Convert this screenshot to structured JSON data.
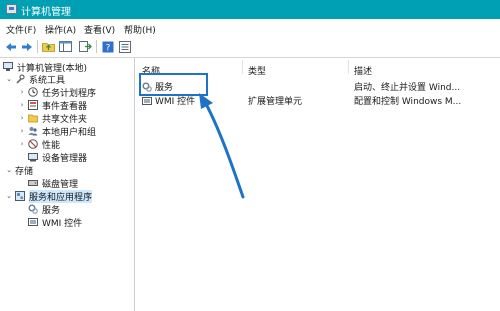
{
  "window": {
    "title": "计算机管理",
    "icon": "computer-management-icon"
  },
  "menu": {
    "file": "文件(F)",
    "action": "操作(A)",
    "view": "查看(V)",
    "help": "帮助(H)"
  },
  "toolbar": {
    "icons": [
      "back-arrow-icon",
      "forward-arrow-icon",
      "folder-up-icon",
      "show-hide-tree-icon",
      "export-list-icon",
      "help-icon",
      "properties-icon"
    ]
  },
  "tree": {
    "root": "计算机管理(本地)",
    "system_tools": "系统工具",
    "task_scheduler": "任务计划程序",
    "event_viewer": "事件查看器",
    "shared_folders": "共享文件夹",
    "local_users_groups": "本地用户和组",
    "performance": "性能",
    "device_manager": "设备管理器",
    "storage": "存储",
    "disk_management": "磁盘管理",
    "services_apps": "服务和应用程序",
    "services": "服务",
    "wmi_control": "WMI 控件"
  },
  "list": {
    "columns": {
      "name": "名称",
      "type": "类型",
      "description": "描述"
    },
    "rows": [
      {
        "name": "服务",
        "type": "",
        "description": "启动、终止并设置 Wind..."
      },
      {
        "name": "WMI 控件",
        "type": "扩展管理单元",
        "description": "配置和控制 Windows M..."
      }
    ]
  },
  "colors": {
    "titlebar": "#00a0b4",
    "highlight_box": "#1e73c8",
    "arrow": "#1e73c8",
    "selection": "#cce8ff"
  }
}
